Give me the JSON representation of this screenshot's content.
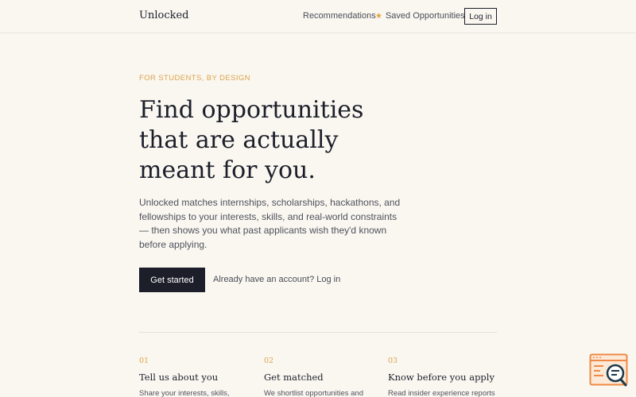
{
  "header": {
    "brand": "Unlocked",
    "nav": {
      "recommendations": "Recommendations",
      "saved_icon": "star-icon",
      "saved": "Saved Opportunities"
    },
    "login": "Log in"
  },
  "hero": {
    "eyebrow": "FOR STUDENTS, BY DESIGN",
    "title": "Find opportunities that are actually meant for you.",
    "lead": "Unlocked matches internships, scholarships, hackathons, and fellowships to your interests, skills, and real-world constraints — then shows you what past applicants wish they'd known before applying.",
    "cta": "Get started",
    "alt_link": "Already have an account? Log in"
  },
  "steps": [
    {
      "num": "01",
      "title": "Tell us about you",
      "desc": "Share your interests, skills,"
    },
    {
      "num": "02",
      "title": "Get matched",
      "desc": "We shortlist opportunities and"
    },
    {
      "num": "03",
      "title": "Know before you apply",
      "desc": "Read insider experience reports"
    }
  ],
  "colors": {
    "background": "#faf7f1",
    "accent": "#dca34a",
    "ink": "#1c1f2a",
    "widget": "#ee8a45"
  },
  "widget_icon": "search-help-icon"
}
